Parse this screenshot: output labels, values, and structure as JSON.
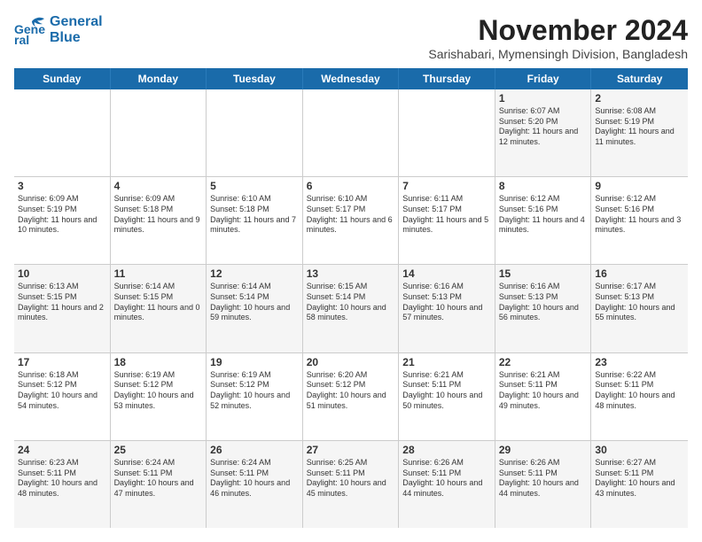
{
  "logo": {
    "line1": "General",
    "line2": "Blue",
    "icon": "🐦"
  },
  "header": {
    "month": "November 2024",
    "location": "Sarishabari, Mymensingh Division, Bangladesh"
  },
  "weekdays": [
    "Sunday",
    "Monday",
    "Tuesday",
    "Wednesday",
    "Thursday",
    "Friday",
    "Saturday"
  ],
  "rows": [
    {
      "cells": [
        {
          "day": "",
          "text": "",
          "empty": true
        },
        {
          "day": "",
          "text": "",
          "empty": true
        },
        {
          "day": "",
          "text": "",
          "empty": true
        },
        {
          "day": "",
          "text": "",
          "empty": true
        },
        {
          "day": "",
          "text": "",
          "empty": true
        },
        {
          "day": "1",
          "text": "Sunrise: 6:07 AM\nSunset: 5:20 PM\nDaylight: 11 hours and 12 minutes.",
          "empty": false
        },
        {
          "day": "2",
          "text": "Sunrise: 6:08 AM\nSunset: 5:19 PM\nDaylight: 11 hours and 11 minutes.",
          "empty": false
        }
      ]
    },
    {
      "cells": [
        {
          "day": "3",
          "text": "Sunrise: 6:09 AM\nSunset: 5:19 PM\nDaylight: 11 hours and 10 minutes.",
          "empty": false
        },
        {
          "day": "4",
          "text": "Sunrise: 6:09 AM\nSunset: 5:18 PM\nDaylight: 11 hours and 9 minutes.",
          "empty": false
        },
        {
          "day": "5",
          "text": "Sunrise: 6:10 AM\nSunset: 5:18 PM\nDaylight: 11 hours and 7 minutes.",
          "empty": false
        },
        {
          "day": "6",
          "text": "Sunrise: 6:10 AM\nSunset: 5:17 PM\nDaylight: 11 hours and 6 minutes.",
          "empty": false
        },
        {
          "day": "7",
          "text": "Sunrise: 6:11 AM\nSunset: 5:17 PM\nDaylight: 11 hours and 5 minutes.",
          "empty": false
        },
        {
          "day": "8",
          "text": "Sunrise: 6:12 AM\nSunset: 5:16 PM\nDaylight: 11 hours and 4 minutes.",
          "empty": false
        },
        {
          "day": "9",
          "text": "Sunrise: 6:12 AM\nSunset: 5:16 PM\nDaylight: 11 hours and 3 minutes.",
          "empty": false
        }
      ]
    },
    {
      "cells": [
        {
          "day": "10",
          "text": "Sunrise: 6:13 AM\nSunset: 5:15 PM\nDaylight: 11 hours and 2 minutes.",
          "empty": false
        },
        {
          "day": "11",
          "text": "Sunrise: 6:14 AM\nSunset: 5:15 PM\nDaylight: 11 hours and 0 minutes.",
          "empty": false
        },
        {
          "day": "12",
          "text": "Sunrise: 6:14 AM\nSunset: 5:14 PM\nDaylight: 10 hours and 59 minutes.",
          "empty": false
        },
        {
          "day": "13",
          "text": "Sunrise: 6:15 AM\nSunset: 5:14 PM\nDaylight: 10 hours and 58 minutes.",
          "empty": false
        },
        {
          "day": "14",
          "text": "Sunrise: 6:16 AM\nSunset: 5:13 PM\nDaylight: 10 hours and 57 minutes.",
          "empty": false
        },
        {
          "day": "15",
          "text": "Sunrise: 6:16 AM\nSunset: 5:13 PM\nDaylight: 10 hours and 56 minutes.",
          "empty": false
        },
        {
          "day": "16",
          "text": "Sunrise: 6:17 AM\nSunset: 5:13 PM\nDaylight: 10 hours and 55 minutes.",
          "empty": false
        }
      ]
    },
    {
      "cells": [
        {
          "day": "17",
          "text": "Sunrise: 6:18 AM\nSunset: 5:12 PM\nDaylight: 10 hours and 54 minutes.",
          "empty": false
        },
        {
          "day": "18",
          "text": "Sunrise: 6:19 AM\nSunset: 5:12 PM\nDaylight: 10 hours and 53 minutes.",
          "empty": false
        },
        {
          "day": "19",
          "text": "Sunrise: 6:19 AM\nSunset: 5:12 PM\nDaylight: 10 hours and 52 minutes.",
          "empty": false
        },
        {
          "day": "20",
          "text": "Sunrise: 6:20 AM\nSunset: 5:12 PM\nDaylight: 10 hours and 51 minutes.",
          "empty": false
        },
        {
          "day": "21",
          "text": "Sunrise: 6:21 AM\nSunset: 5:11 PM\nDaylight: 10 hours and 50 minutes.",
          "empty": false
        },
        {
          "day": "22",
          "text": "Sunrise: 6:21 AM\nSunset: 5:11 PM\nDaylight: 10 hours and 49 minutes.",
          "empty": false
        },
        {
          "day": "23",
          "text": "Sunrise: 6:22 AM\nSunset: 5:11 PM\nDaylight: 10 hours and 48 minutes.",
          "empty": false
        }
      ]
    },
    {
      "cells": [
        {
          "day": "24",
          "text": "Sunrise: 6:23 AM\nSunset: 5:11 PM\nDaylight: 10 hours and 48 minutes.",
          "empty": false
        },
        {
          "day": "25",
          "text": "Sunrise: 6:24 AM\nSunset: 5:11 PM\nDaylight: 10 hours and 47 minutes.",
          "empty": false
        },
        {
          "day": "26",
          "text": "Sunrise: 6:24 AM\nSunset: 5:11 PM\nDaylight: 10 hours and 46 minutes.",
          "empty": false
        },
        {
          "day": "27",
          "text": "Sunrise: 6:25 AM\nSunset: 5:11 PM\nDaylight: 10 hours and 45 minutes.",
          "empty": false
        },
        {
          "day": "28",
          "text": "Sunrise: 6:26 AM\nSunset: 5:11 PM\nDaylight: 10 hours and 44 minutes.",
          "empty": false
        },
        {
          "day": "29",
          "text": "Sunrise: 6:26 AM\nSunset: 5:11 PM\nDaylight: 10 hours and 44 minutes.",
          "empty": false
        },
        {
          "day": "30",
          "text": "Sunrise: 6:27 AM\nSunset: 5:11 PM\nDaylight: 10 hours and 43 minutes.",
          "empty": false
        }
      ]
    }
  ]
}
